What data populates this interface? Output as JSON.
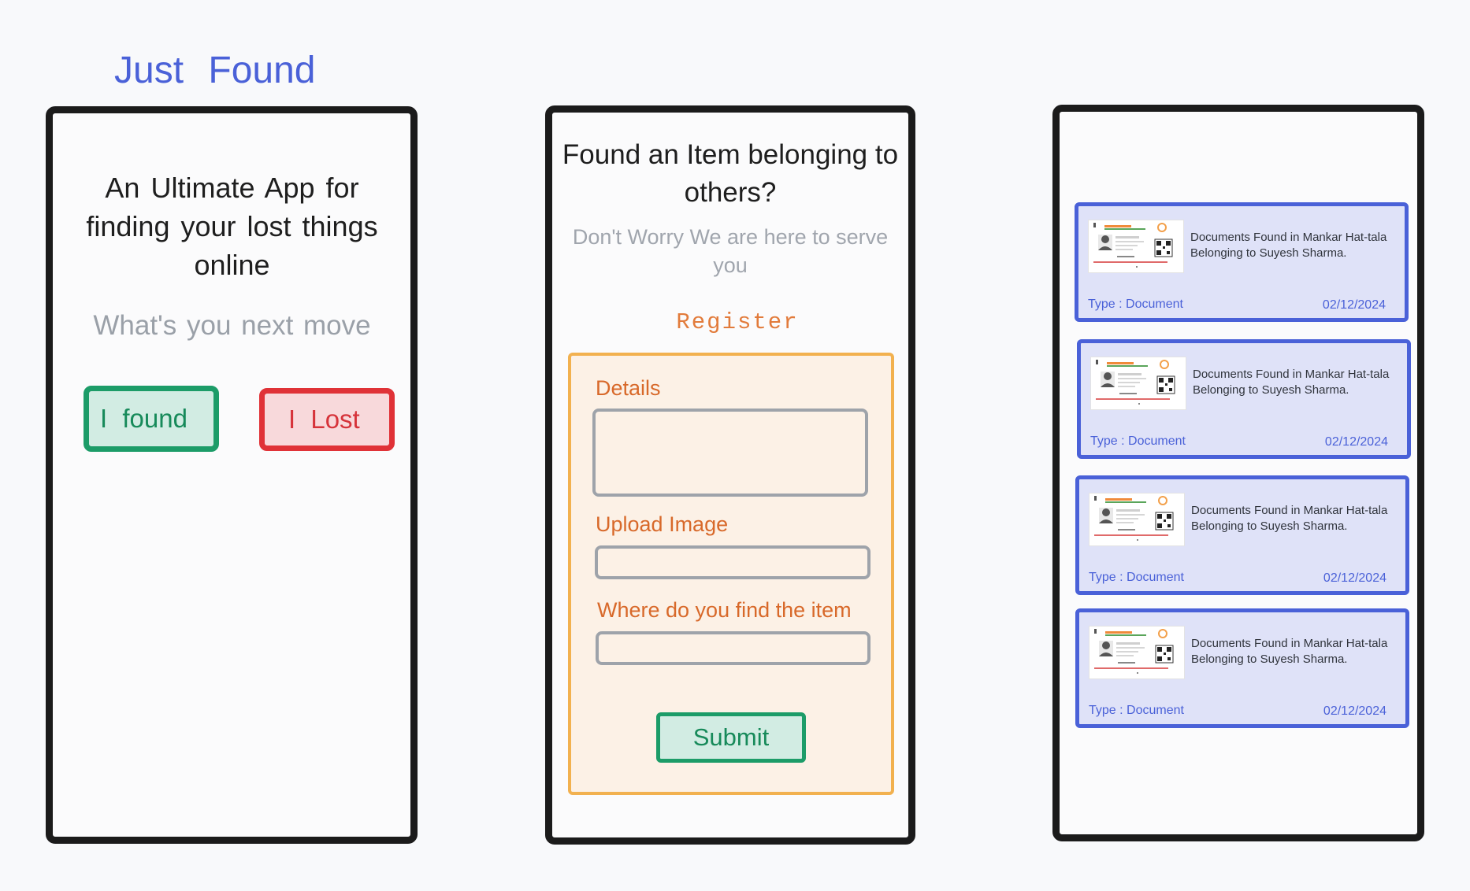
{
  "app": {
    "title": "Just  Found"
  },
  "landing": {
    "headline": "An Ultimate  App for finding  your lost  things online",
    "subheadline": "What's  you next  move",
    "found_button": "I  found",
    "lost_button": "I  Lost"
  },
  "register_screen": {
    "headline": "Found an Item  belonging to others?",
    "subheadline": "Don't Worry We are here to serve you",
    "register_label": "Register",
    "form": {
      "details_label": "Details",
      "details_value": "",
      "upload_label": "Upload Image",
      "upload_value": "",
      "location_label": "Where do you find  the  item",
      "location_value": "",
      "submit_label": "Submit"
    }
  },
  "found_list": {
    "items": [
      {
        "description": "Documents Found in Mankar Hat-tala Belonging to Suyesh Sharma.",
        "type": "Type : Document",
        "date": "02/12/2024",
        "thumbnail": "id-card-image"
      },
      {
        "description": "Documents Found in Mankar Hat-tala Belonging to Suyesh Sharma.",
        "type": "Type : Document",
        "date": "02/12/2024",
        "thumbnail": "id-card-image"
      },
      {
        "description": "Documents Found in Mankar Hat-tala Belonging to Suyesh Sharma.",
        "type": "Type : Document",
        "date": "02/12/2024",
        "thumbnail": "id-card-image"
      },
      {
        "description": "Documents Found in Mankar Hat-tala Belonging to Suyesh Sharma.",
        "type": "Type : Document",
        "date": "02/12/2024",
        "thumbnail": "id-card-image"
      }
    ]
  },
  "colors": {
    "brand": "#4a61d8",
    "found_green": "#1c9c68",
    "lost_red": "#e03237",
    "form_orange": "#f2b14f",
    "label_orange": "#d8692a"
  }
}
